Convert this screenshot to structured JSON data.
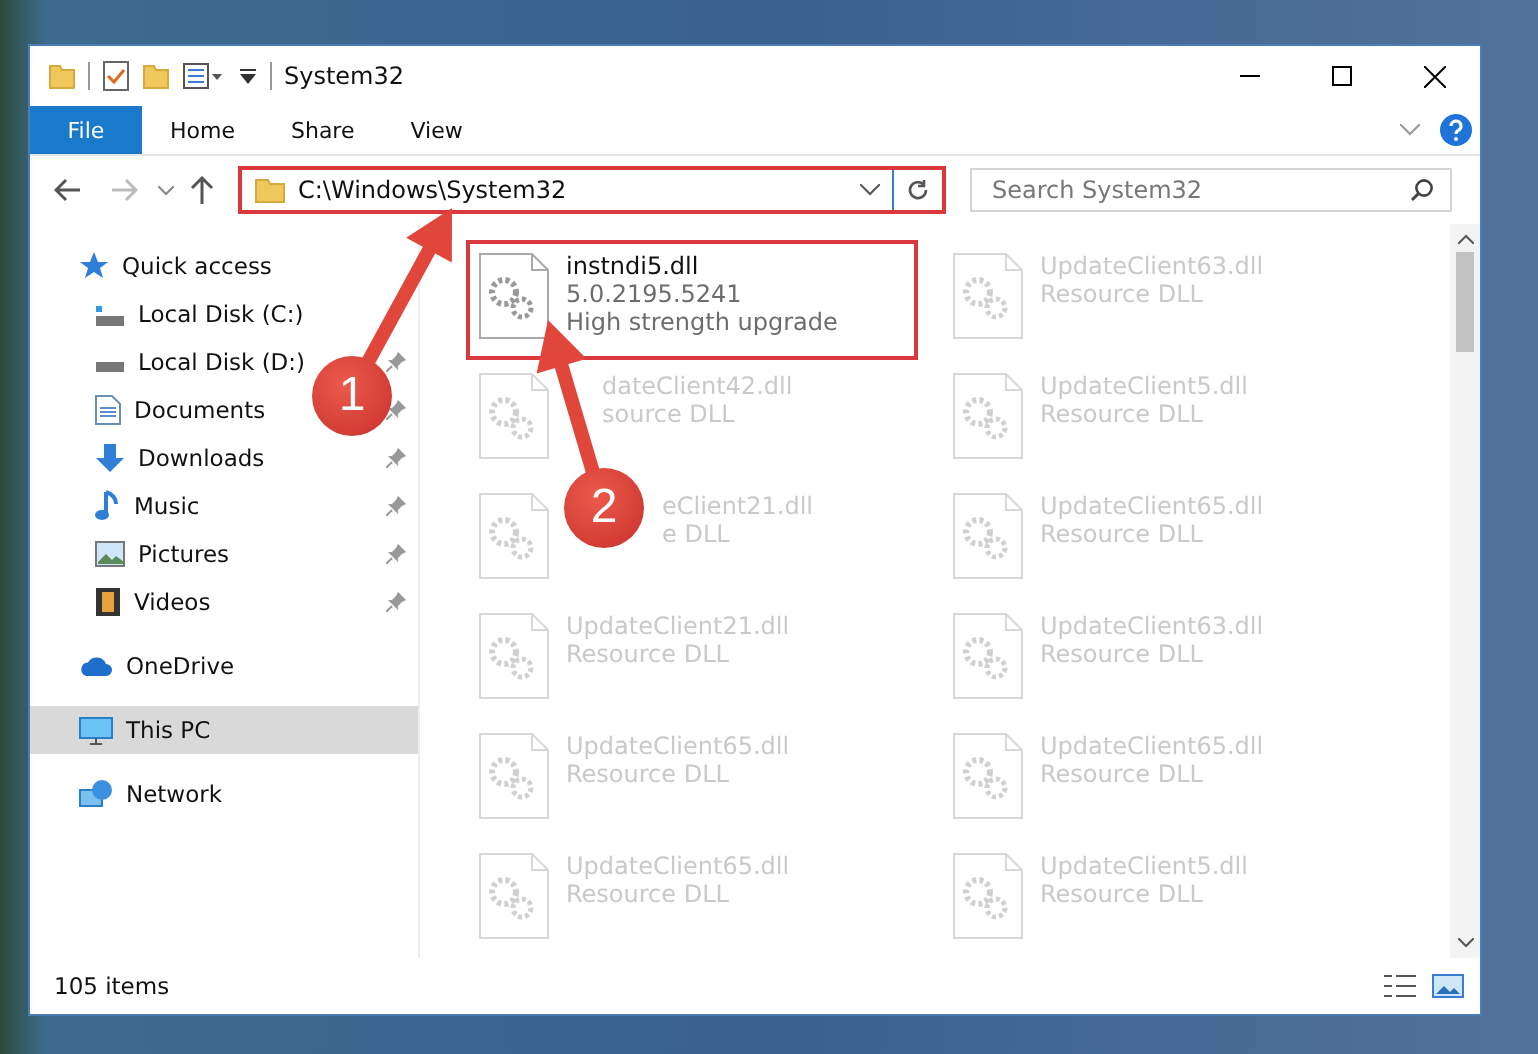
{
  "window": {
    "title": "System32"
  },
  "ribbon": {
    "tabs": [
      {
        "label": "File",
        "selected": true
      },
      {
        "label": "Home",
        "selected": false
      },
      {
        "label": "Share",
        "selected": false
      },
      {
        "label": "View",
        "selected": false
      }
    ]
  },
  "address": {
    "path": "C:\\Windows\\System32",
    "highlighted": true
  },
  "search": {
    "placeholder": "Search System32"
  },
  "sidebar": {
    "items": [
      {
        "label": "Quick access",
        "selected": false,
        "children": [
          {
            "label": "Local Disk (C:)",
            "pinned": false
          },
          {
            "label": "Local Disk (D:)",
            "pinned": true
          },
          {
            "label": "Documents",
            "pinned": true
          },
          {
            "label": "Downloads",
            "pinned": true
          },
          {
            "label": "Music",
            "pinned": true
          },
          {
            "label": "Pictures",
            "pinned": true
          },
          {
            "label": "Videos",
            "pinned": true
          }
        ]
      },
      {
        "label": "OneDrive",
        "selected": false
      },
      {
        "label": "This PC",
        "selected": true
      },
      {
        "label": "Network",
        "selected": false
      }
    ]
  },
  "files": [
    {
      "name": "instndi5.dll",
      "lines": [
        "5.0.2195.5241",
        "High strength upgrade"
      ],
      "highlighted": true,
      "blurred": false
    },
    {
      "name": "UpdateClient63.dll",
      "lines": [
        "Resource DLL"
      ],
      "highlighted": false,
      "blurred": true
    },
    {
      "name": "dateClient42.dll",
      "lines": [
        "source DLL"
      ],
      "highlighted": false,
      "blurred": true,
      "kind": "arrowed"
    },
    {
      "name": "UpdateClient5.dll",
      "lines": [
        "Resource DLL"
      ],
      "highlighted": false,
      "blurred": true
    },
    {
      "name": "eClient21.dll",
      "lines": [
        "e DLL"
      ],
      "highlighted": false,
      "blurred": true,
      "kind": "badged"
    },
    {
      "name": "UpdateClient65.dll",
      "lines": [
        "Resource DLL"
      ],
      "highlighted": false,
      "blurred": true
    },
    {
      "name": "UpdateClient21.dll",
      "lines": [
        "Resource DLL"
      ],
      "highlighted": false,
      "blurred": true
    },
    {
      "name": "UpdateClient63.dll",
      "lines": [
        "Resource DLL"
      ],
      "highlighted": false,
      "blurred": true
    },
    {
      "name": "UpdateClient65.dll",
      "lines": [
        "Resource DLL"
      ],
      "highlighted": false,
      "blurred": true
    },
    {
      "name": "UpdateClient65.dll",
      "lines": [
        "Resource DLL"
      ],
      "highlighted": false,
      "blurred": true
    },
    {
      "name": "UpdateClient65.dll",
      "lines": [
        "Resource DLL"
      ],
      "highlighted": false,
      "blurred": true
    },
    {
      "name": "UpdateClient5.dll",
      "lines": [
        "Resource DLL"
      ],
      "highlighted": false,
      "blurred": true
    }
  ],
  "status_bar": {
    "item_count": "105 items"
  },
  "annotations": [
    {
      "number": "1"
    },
    {
      "number": "2"
    }
  ]
}
